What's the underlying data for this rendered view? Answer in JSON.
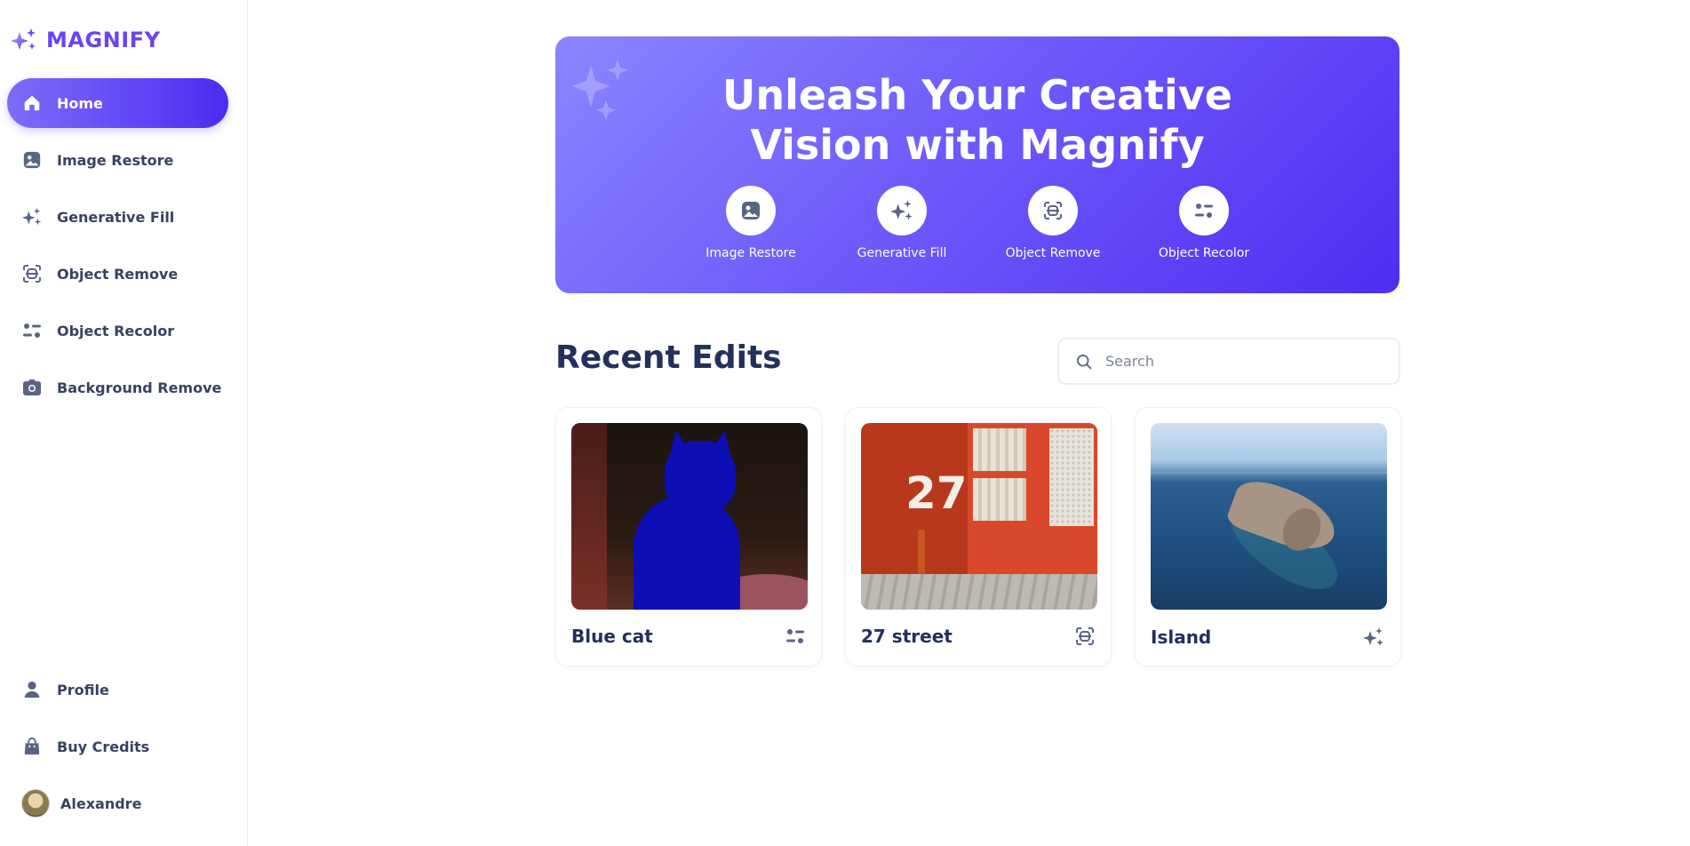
{
  "app": {
    "name": "MAGNIFY"
  },
  "sidebar": {
    "items": [
      {
        "label": "Home",
        "icon": "home-icon",
        "active": true
      },
      {
        "label": "Image Restore",
        "icon": "image-icon",
        "active": false
      },
      {
        "label": "Generative Fill",
        "icon": "sparkles-icon",
        "active": false
      },
      {
        "label": "Object Remove",
        "icon": "scan-icon",
        "active": false
      },
      {
        "label": "Object Recolor",
        "icon": "recolor-icon",
        "active": false
      },
      {
        "label": "Background Remove",
        "icon": "camera-icon",
        "active": false
      }
    ],
    "bottom": [
      {
        "label": "Profile",
        "icon": "profile-icon"
      },
      {
        "label": "Buy Credits",
        "icon": "bag-icon"
      }
    ],
    "user": {
      "name": "Alexandre"
    }
  },
  "hero": {
    "title_line1": "Unleash Your Creative",
    "title_line2": "Vision with Magnify",
    "tools": [
      {
        "label": "Image Restore",
        "icon": "image-icon"
      },
      {
        "label": "Generative Fill",
        "icon": "sparkles-icon"
      },
      {
        "label": "Object Remove",
        "icon": "scan-icon"
      },
      {
        "label": "Object Recolor",
        "icon": "recolor-icon"
      }
    ]
  },
  "recent": {
    "title": "Recent Edits",
    "search_placeholder": "Search",
    "cards": [
      {
        "title": "Blue cat",
        "icon": "recolor-icon"
      },
      {
        "title": "27 street",
        "icon": "scan-icon"
      },
      {
        "title": "Island",
        "icon": "sparkles-icon"
      }
    ],
    "street_number": "27"
  },
  "colors": {
    "accent": "#6a44f2",
    "text_primary": "#23305e",
    "text_secondary": "#384262",
    "hero_gradient_start": "#8b86ff",
    "hero_gradient_end": "#4f2df2"
  }
}
